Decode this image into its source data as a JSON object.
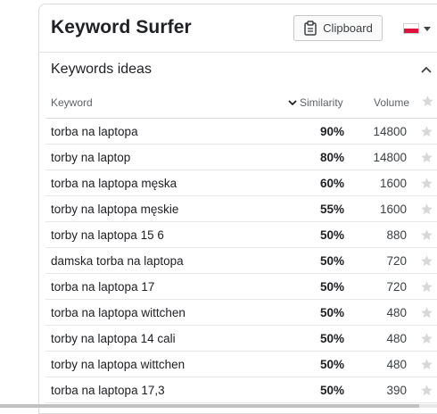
{
  "app": {
    "title": "Keyword Surfer"
  },
  "toolbar": {
    "clipboard_label": "Clipboard",
    "flag_icon": "poland-flag-icon"
  },
  "section": {
    "title": "Keywords ideas"
  },
  "table": {
    "headers": {
      "keyword": "Keyword",
      "similarity": "Similarity",
      "volume": "Volume"
    },
    "rows": [
      {
        "keyword": "torba na laptopa",
        "similarity": "90%",
        "volume": "14800"
      },
      {
        "keyword": "torby na laptop",
        "similarity": "80%",
        "volume": "14800"
      },
      {
        "keyword": "torba na laptopa męska",
        "similarity": "60%",
        "volume": "1600"
      },
      {
        "keyword": "torby na laptopa męskie",
        "similarity": "55%",
        "volume": "1600"
      },
      {
        "keyword": "torby na laptopa 15 6",
        "similarity": "50%",
        "volume": "880"
      },
      {
        "keyword": "damska torba na laptopa",
        "similarity": "50%",
        "volume": "720"
      },
      {
        "keyword": "torba na laptopa 17",
        "similarity": "50%",
        "volume": "720"
      },
      {
        "keyword": "torba na laptopa wittchen",
        "similarity": "50%",
        "volume": "480"
      },
      {
        "keyword": "torby na laptopa 14 cali",
        "similarity": "50%",
        "volume": "480"
      },
      {
        "keyword": "torby na laptopa wittchen",
        "similarity": "50%",
        "volume": "480"
      },
      {
        "keyword": "torba na laptopa 17,3",
        "similarity": "50%",
        "volume": "390"
      }
    ]
  },
  "colors": {
    "star": "#d8d8d8",
    "border": "#dadce0",
    "flag_red": "#dc143c"
  }
}
